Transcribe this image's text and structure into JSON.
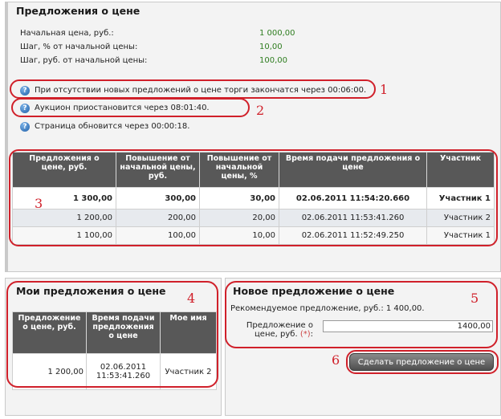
{
  "price_panel": {
    "title": "Предложения о цене",
    "info": [
      {
        "label": "Начальная цена, руб.:",
        "value": "1 000,00"
      },
      {
        "label": "Шаг, % от начальной цены:",
        "value": "10,00"
      },
      {
        "label": "Шаг, руб. от начальной цены:",
        "value": "100,00"
      }
    ],
    "notices": [
      "При отсутствии новых предложений о цене торги закончатся через 00:06:00.",
      "Аукцион приостановится через 08:01:40.",
      "Страница обновится через 00:00:18."
    ],
    "table": {
      "headers": [
        "Предложения о цене, руб.",
        "Повышение от начальной цены, руб.",
        "Повышение от начальной цены, %",
        "Время подачи предложения о цене",
        "Участник"
      ],
      "rows": [
        [
          "1 300,00",
          "300,00",
          "30,00",
          "02.06.2011 11:54:20.660",
          "Участник 1"
        ],
        [
          "1 200,00",
          "200,00",
          "20,00",
          "02.06.2011 11:53:41.260",
          "Участник 2"
        ],
        [
          "1 100,00",
          "100,00",
          "10,00",
          "02.06.2011 11:52:49.250",
          "Участник 1"
        ]
      ]
    }
  },
  "my_bids": {
    "title": "Мои предложения о цене",
    "headers": [
      "Предложение о цене, руб.",
      "Время подачи предложения о цене",
      "Мое имя"
    ],
    "rows": [
      [
        "1 200,00",
        "02.06.2011 11:53:41.260",
        "Участник 2"
      ]
    ]
  },
  "new_bid": {
    "title": "Новое предложение о цене",
    "recommended": "Рекомендуемое предложение, руб.: 1 400,00.",
    "field_label": "Предложение о цене, руб.",
    "required_mark": "(*)",
    "field_suffix": ":",
    "value": "1400,00",
    "submit_label": "Сделать предложение о цене"
  },
  "annotations": [
    "1",
    "2",
    "3",
    "4",
    "5",
    "6"
  ],
  "colors": {
    "accent_red": "#d0202a",
    "value_green": "#2e7d1f",
    "header_gray": "#585858"
  },
  "icons": {
    "notice": "question-icon"
  }
}
